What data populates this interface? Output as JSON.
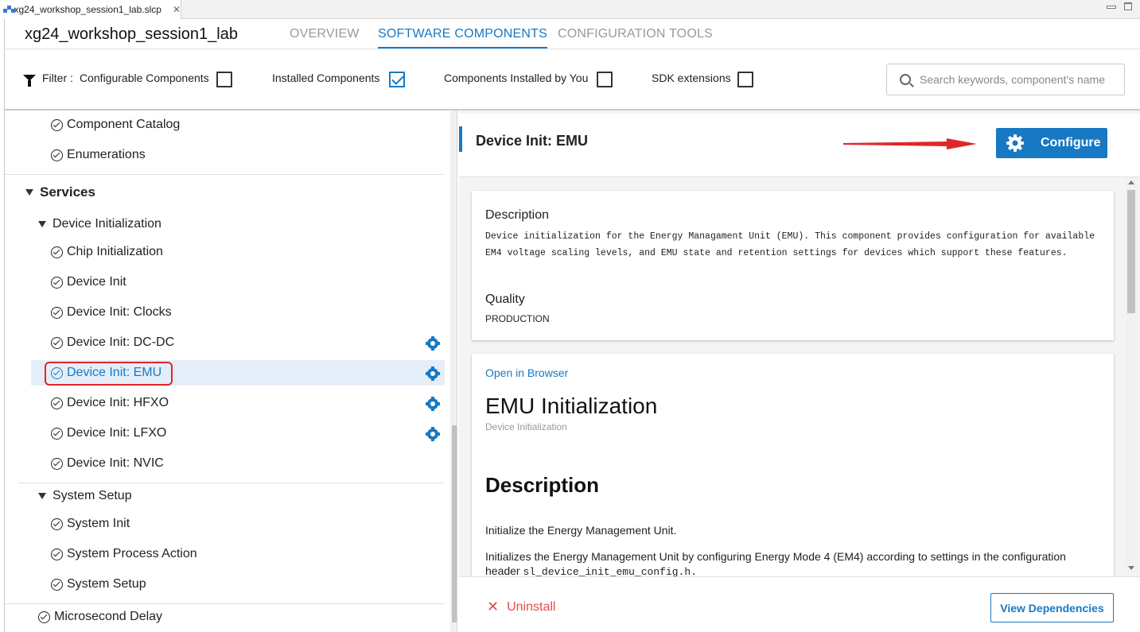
{
  "editor_tab": {
    "filename": "xg24_workshop_session1_lab.slcp",
    "close": "✕"
  },
  "header": {
    "project_title": "xg24_workshop_session1_lab",
    "tabs": [
      {
        "label": "OVERVIEW",
        "active": false
      },
      {
        "label": "SOFTWARE COMPONENTS",
        "active": true
      },
      {
        "label": "CONFIGURATION TOOLS",
        "active": false
      }
    ]
  },
  "filter": {
    "prefix": "Filter :",
    "options": [
      {
        "label": "Configurable Components",
        "checked": false
      },
      {
        "label": "Installed Components",
        "checked": true
      },
      {
        "label": "Components Installed by You",
        "checked": false
      },
      {
        "label": "SDK extensions",
        "checked": false
      }
    ],
    "search_placeholder": "Search keywords, component's name"
  },
  "tree": {
    "items": [
      {
        "label": "Component Catalog"
      },
      {
        "label": "Enumerations"
      },
      {
        "label": "Services"
      },
      {
        "label": "Device Initialization"
      },
      {
        "label": "Chip Initialization"
      },
      {
        "label": "Device Init"
      },
      {
        "label": "Device Init: Clocks"
      },
      {
        "label": "Device Init: DC-DC",
        "configurable": true
      },
      {
        "label": "Device Init: EMU",
        "configurable": true,
        "selected": true
      },
      {
        "label": "Device Init: HFXO",
        "configurable": true
      },
      {
        "label": "Device Init: LFXO",
        "configurable": true
      },
      {
        "label": "Device Init: NVIC"
      },
      {
        "label": "System Setup"
      },
      {
        "label": "System Init"
      },
      {
        "label": "System Process Action"
      },
      {
        "label": "System Setup"
      },
      {
        "label": "Microsecond Delay"
      }
    ]
  },
  "detail": {
    "title": "Device Init: EMU",
    "configure_label": "Configure",
    "description_heading": "Description",
    "description_text": "Device initialization for the Energy Managament Unit (EMU). This component provides configuration for available EM4 voltage scaling levels, and EMU state and retention settings for devices which support these features.",
    "quality_heading": "Quality",
    "quality_value": "PRODUCTION",
    "doc": {
      "open_in_browser": "Open in Browser",
      "title": "EMU Initialization",
      "subtitle": "Device Initialization",
      "section_heading": "Description",
      "para1": "Initialize the Energy Management Unit.",
      "para2_text": "Initializes the Energy Management Unit by configuring Energy Mode 4 (EM4) according to settings in the configuration header",
      "para2_code": "sl_device_init_emu_config.h."
    },
    "uninstall_label": "Uninstall",
    "view_dependencies_label": "View Dependencies"
  },
  "colors": {
    "accent": "#1779c4",
    "danger": "#e24b4b",
    "highlight_box": "#e0262a"
  }
}
